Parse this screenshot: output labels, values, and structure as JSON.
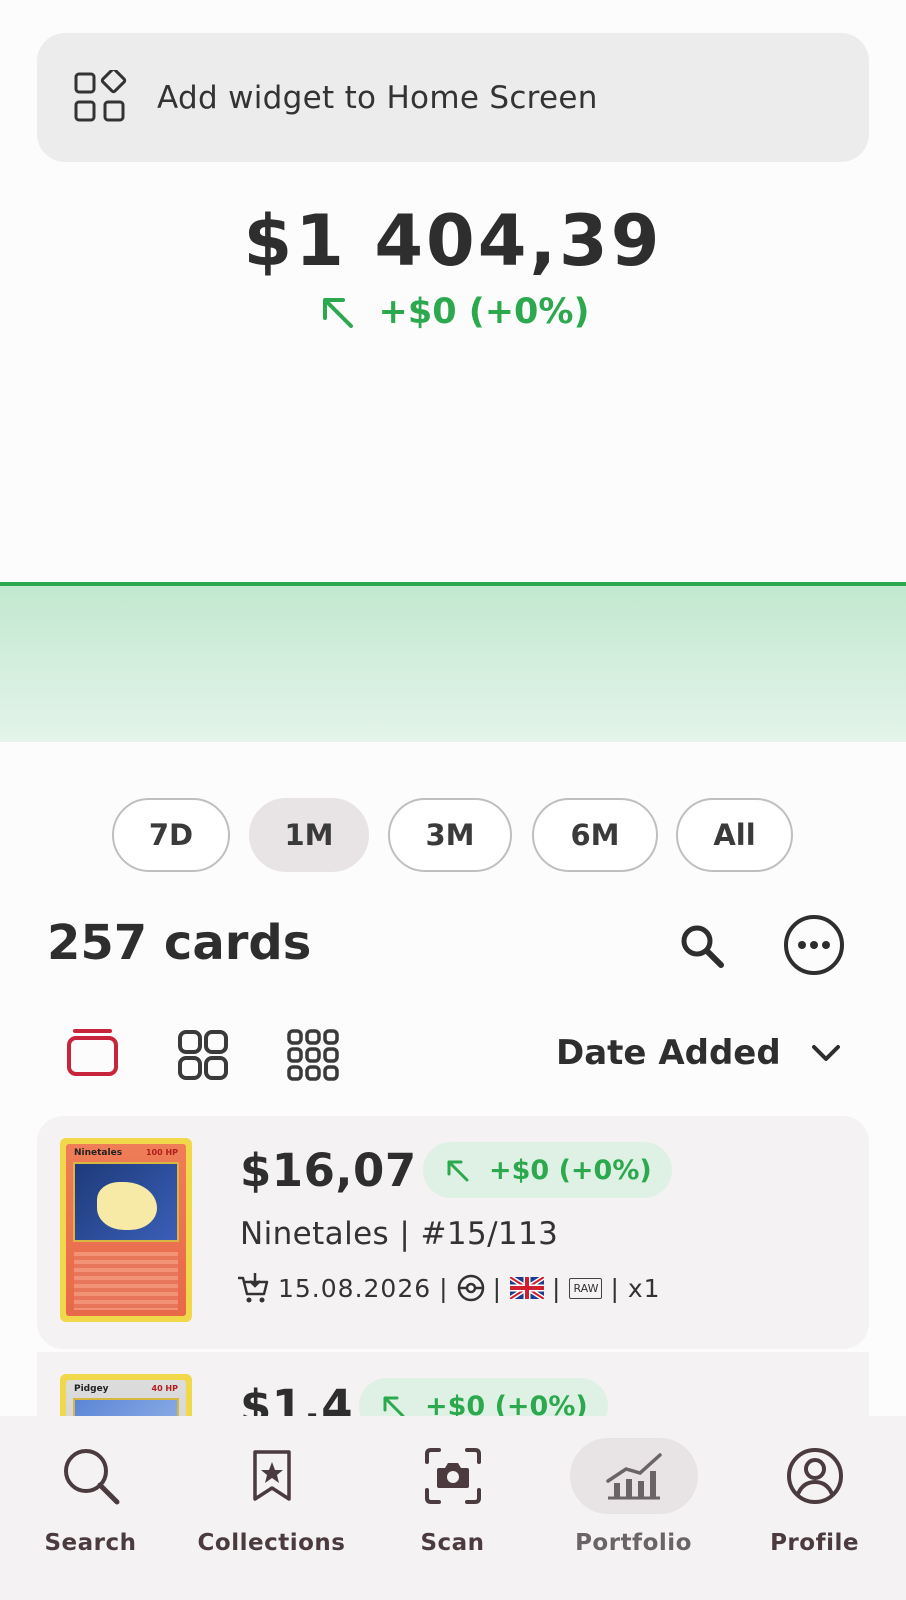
{
  "widget_banner": {
    "label": "Add widget to Home Screen"
  },
  "portfolio": {
    "total_value": "$1 404,39",
    "change": "+$0 (+0%)",
    "accent": "#2ca94e",
    "chart_fill": "#c8ead3"
  },
  "time_ranges": [
    {
      "label": "7D",
      "active": false
    },
    {
      "label": "1M",
      "active": true
    },
    {
      "label": "3M",
      "active": false
    },
    {
      "label": "6M",
      "active": false
    },
    {
      "label": "All",
      "active": false
    }
  ],
  "collection": {
    "count_label": "257 cards",
    "sort_label": "Date Added",
    "view_modes": [
      "list-view-icon",
      "grid-2-view-icon",
      "grid-3-view-icon"
    ],
    "active_view_color": "#c8243c"
  },
  "cards": [
    {
      "price": "$16,07",
      "delta": "+$0 (+0%)",
      "name": "Ninetales | #15/113",
      "date": "15.08.2026",
      "condition": "RAW",
      "quantity": "x1",
      "thumb_title": "Ninetales",
      "thumb_hp": "100 HP"
    },
    {
      "price": "$1,4",
      "delta": "+$0 (+0%)",
      "thumb_title": "Pidgey",
      "thumb_hp": "40 HP"
    }
  ],
  "nav": [
    {
      "label": "Search",
      "icon": "search-icon",
      "active": false
    },
    {
      "label": "Collections",
      "icon": "bookmark-star-icon",
      "active": false
    },
    {
      "label": "Scan",
      "icon": "camera-scan-icon",
      "active": false
    },
    {
      "label": "Portfolio",
      "icon": "bar-chart-icon",
      "active": true
    },
    {
      "label": "Profile",
      "icon": "profile-icon",
      "active": false
    }
  ]
}
